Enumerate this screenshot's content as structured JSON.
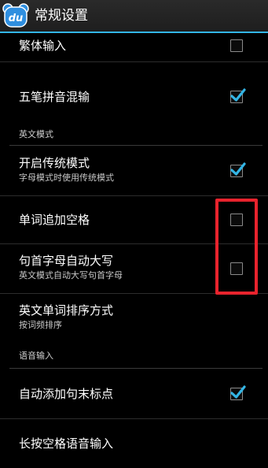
{
  "app_bar": {
    "icon_name": "du-bear-app-icon",
    "icon_text": "du",
    "title": "常规设置"
  },
  "settings": [
    {
      "type": "item",
      "title": "繁体输入",
      "checked": false
    },
    {
      "type": "item",
      "title": "五笔拼音混输",
      "checked": true
    },
    {
      "type": "section",
      "title": "英文模式"
    },
    {
      "type": "item",
      "title": "开启传统模式",
      "summary": "字母模式时使用传统模式",
      "checked": true
    },
    {
      "type": "item",
      "title": "单词追加空格",
      "checked": false
    },
    {
      "type": "item",
      "title": "句首字母自动大写",
      "summary": "英文模式自动大写句首字母",
      "checked": false
    },
    {
      "type": "item",
      "title": "英文单词排序方式",
      "summary": "按词频排序"
    },
    {
      "type": "section",
      "title": "语音输入"
    },
    {
      "type": "item",
      "title": "自动添加句末标点",
      "checked": true
    },
    {
      "type": "item",
      "title": "长按空格语音输入"
    }
  ],
  "colors": {
    "accent": "#33b5e5",
    "highlight": "#e8232d",
    "background": "#000000"
  }
}
